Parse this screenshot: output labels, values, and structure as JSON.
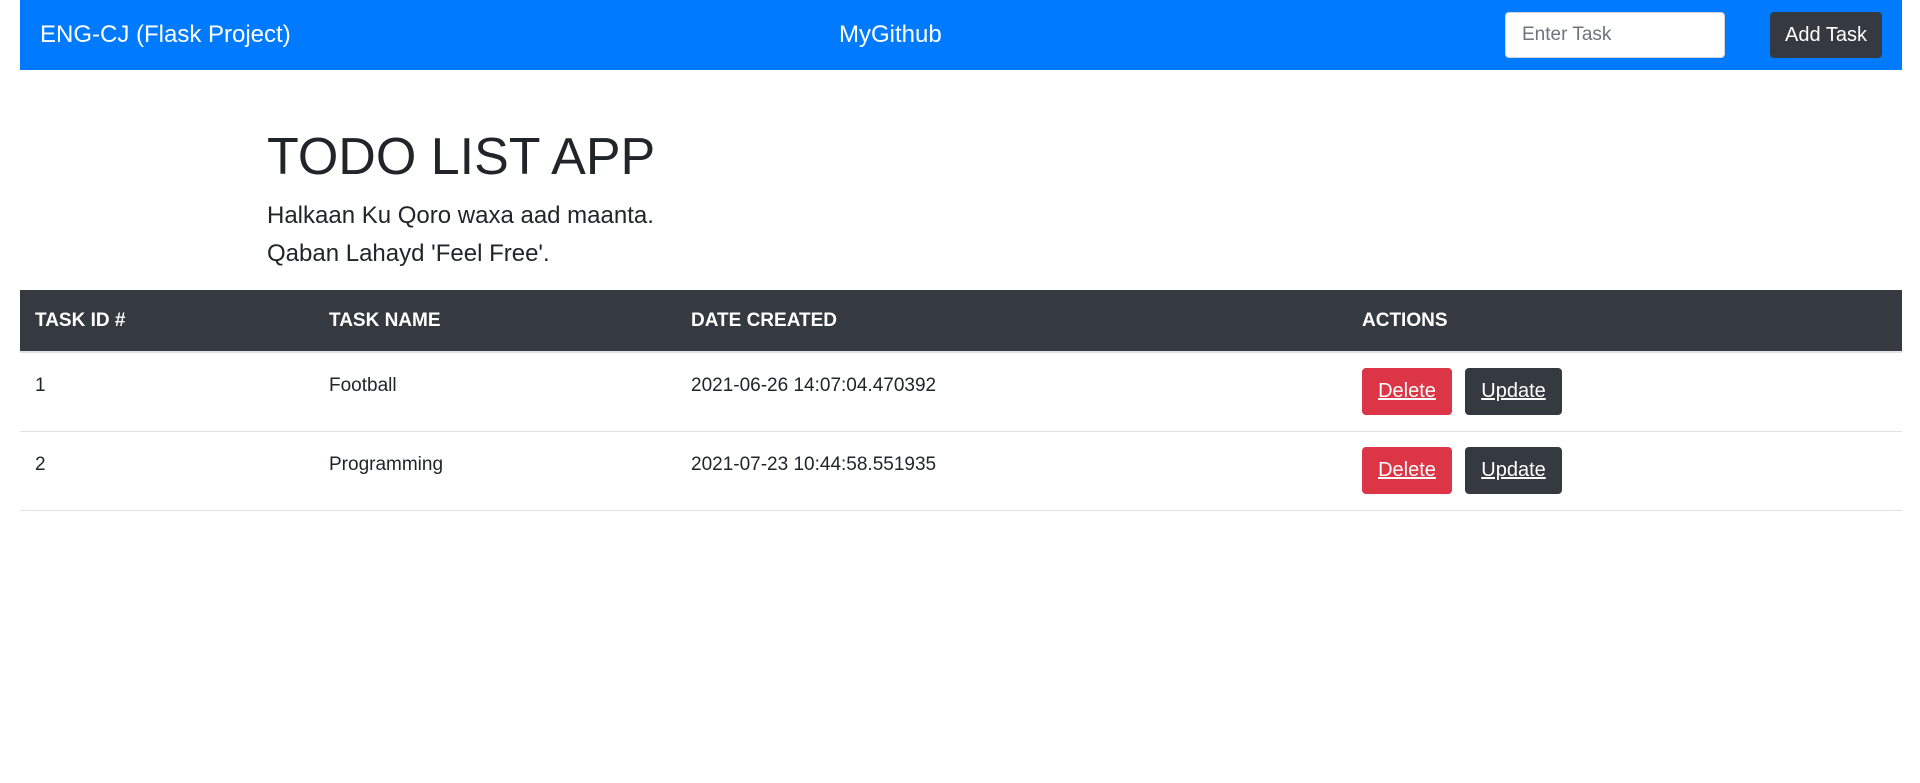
{
  "navbar": {
    "brand": "ENG-CJ (Flask Project)",
    "link": "MyGithub",
    "input_placeholder": "Enter Task",
    "input_value": "",
    "add_button_label": "Add Task",
    "background_color": "#007bff"
  },
  "header": {
    "title": "TODO LIST APP",
    "lead_line_1": "Halkaan Ku Qoro waxa aad maanta.",
    "lead_line_2": "Qaban Lahayd 'Feel Free'."
  },
  "table": {
    "columns": [
      "TASK ID #",
      "TASK NAME",
      "DATE CREATED",
      "ACTIONS"
    ],
    "header_color": "#343a40",
    "rows": [
      {
        "id": "1",
        "name": "Football",
        "date_created": "2021-06-26 14:07:04.470392",
        "delete_label": "Delete",
        "update_label": "Update"
      },
      {
        "id": "2",
        "name": "Programming",
        "date_created": "2021-07-23 10:44:58.551935",
        "delete_label": "Delete",
        "update_label": "Update"
      }
    ]
  },
  "colors": {
    "primary": "#007bff",
    "dark": "#343a40",
    "danger": "#dc3545"
  }
}
